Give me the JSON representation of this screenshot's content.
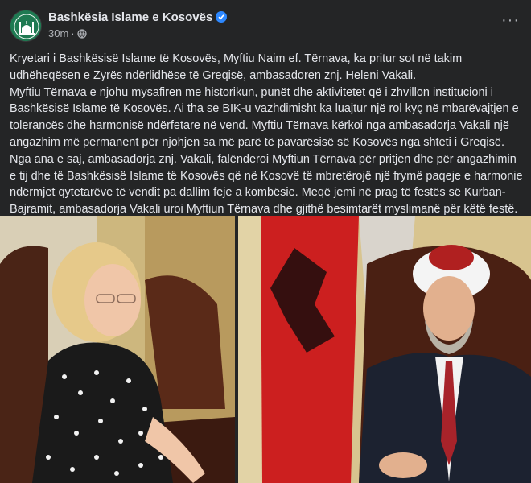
{
  "post": {
    "page_name": "Bashkësia Islame e Kosovës",
    "timestamp": "30m",
    "separator": "·",
    "more_label": "···",
    "paragraphs": [
      "Kryetari i Bashkësisë Islame të Kosovës, Myftiu Naim ef. Tërnava, ka pritur sot në takim udhëheqësen e Zyrës ndërlidhëse të Greqisë, ambasadoren znj. Heleni Vakali.",
      "Myftiu Tërnava e njohu mysafiren me historikun, punët dhe aktivitetet që i zhvillon institucioni i Bashkësisë Islame të Kosovës. Ai tha se BIK-u vazhdimisht ka luajtur një rol kyç në mbarëvajtjen e tolerancës dhe harmonisë ndërfetare në vend. Myftiu Tërnava kërkoi nga ambasadorja Vakali një angazhim më permanent për njohjen sa më parë të pavarësisë së Kosovës nga shteti i Greqisë.",
      "Nga ana e saj, ambasadorja znj. Vakali, falënderoi Myftiun Tërnava për pritjen dhe për angazhimin e tij dhe të Bashkësisë Islame të Kosovës që në Kosovë të mbretërojë një frymë paqeje e harmonie ndërmjet qytetarëve të vendit pa dallim feje a kombësie. Meqë jemi në prag të festës së Kurban-Bajramit, ambasadorja Vakali uroi Myftiun Tërnava dhe gjithë besimtarët myslimanë për këtë festë."
    ]
  },
  "icons": {
    "avatar": "mosque-logo-icon",
    "verified": "verified-badge-icon",
    "privacy": "globe-icon",
    "more": "more-options-icon"
  },
  "colors": {
    "background": "#242526",
    "text": "#e4e6eb",
    "secondary_text": "#b0b3b8",
    "verified": "#2d88ff",
    "logo_green": "#1f7a52"
  }
}
